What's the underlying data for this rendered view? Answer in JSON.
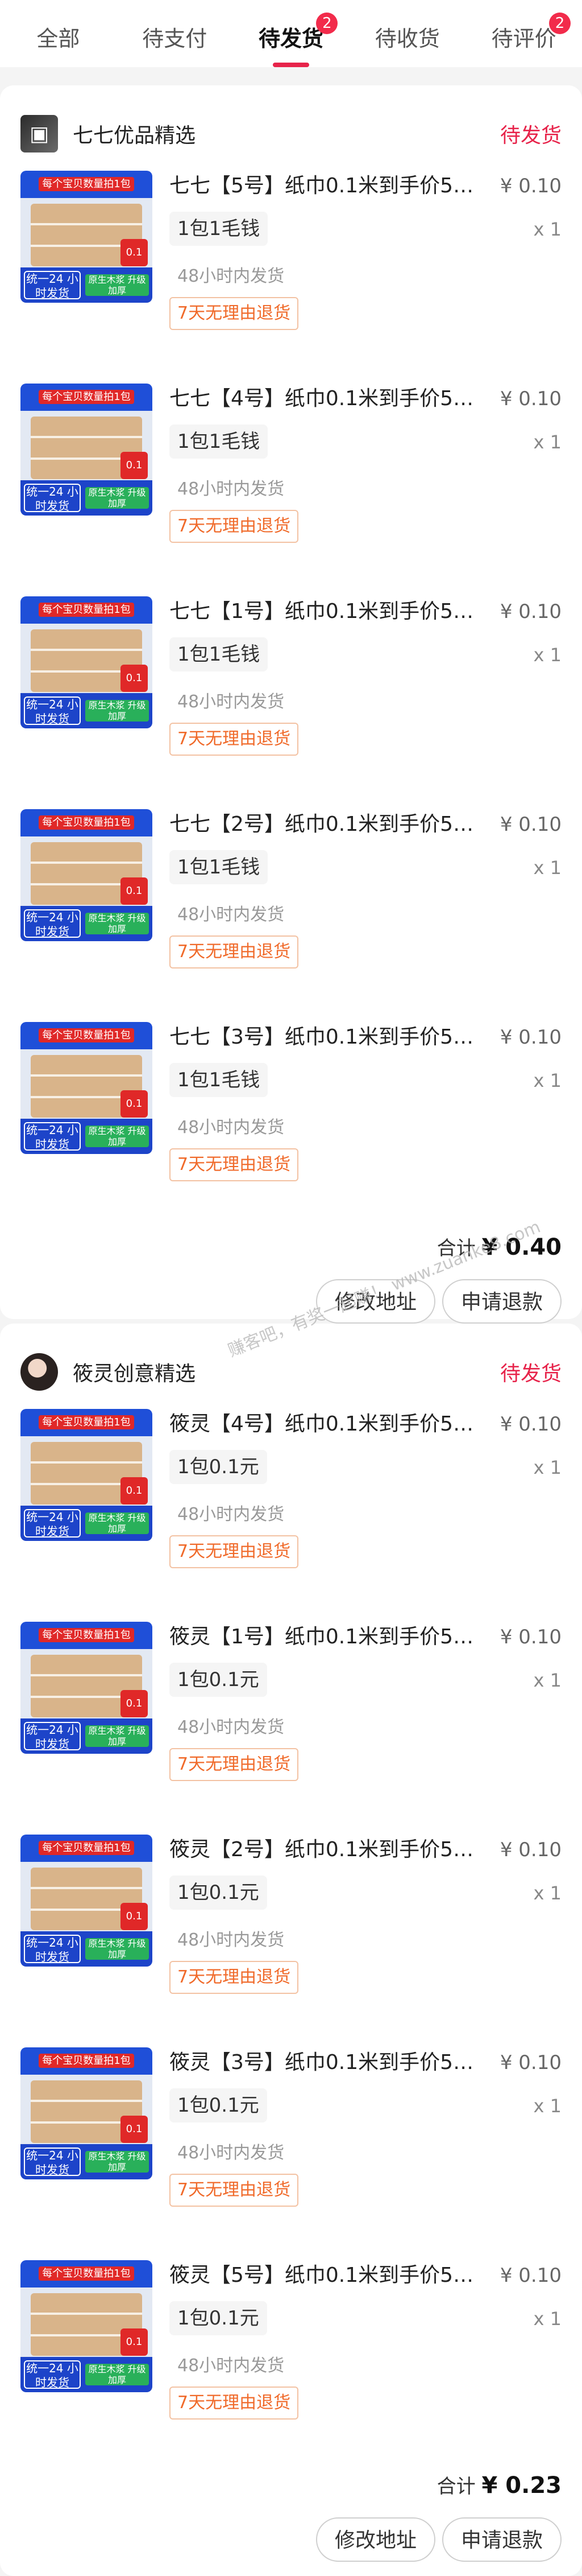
{
  "tabs": [
    {
      "label": "全部",
      "badge": ""
    },
    {
      "label": "待支付",
      "badge": ""
    },
    {
      "label": "待发货",
      "badge": "2"
    },
    {
      "label": "待收货",
      "badge": ""
    },
    {
      "label": "待评价",
      "badge": "2"
    }
  ],
  "orders": [
    {
      "shop": "七七优品精选",
      "status": "待发货",
      "items": [
        {
          "title": "七七【5号】纸巾0.1米到手价5个链…",
          "price": "¥ 0.10",
          "qty": "x 1",
          "spec": "1包1毛钱",
          "ship": "48小时内发货",
          "ret": "7天无理由退货"
        },
        {
          "title": "七七【4号】纸巾0.1米到手价5个链…",
          "price": "¥ 0.10",
          "qty": "x 1",
          "spec": "1包1毛钱",
          "ship": "48小时内发货",
          "ret": "7天无理由退货"
        },
        {
          "title": "七七【1号】纸巾0.1米到手价5个链…",
          "price": "¥ 0.10",
          "qty": "x 1",
          "spec": "1包1毛钱",
          "ship": "48小时内发货",
          "ret": "7天无理由退货"
        },
        {
          "title": "七七【2号】纸巾0.1米到手价5个链…",
          "price": "¥ 0.10",
          "qty": "x 1",
          "spec": "1包1毛钱",
          "ship": "48小时内发货",
          "ret": "7天无理由退货"
        },
        {
          "title": "七七【3号】纸巾0.1米到手价5个链…",
          "price": "¥ 0.10",
          "qty": "x 1",
          "spec": "1包1毛钱",
          "ship": "48小时内发货",
          "ret": "7天无理由退货"
        }
      ],
      "total_label": "合计",
      "total": "¥ 0.40",
      "btn_address": "修改地址",
      "btn_refund": "申请退款"
    },
    {
      "shop": "筱灵创意精选",
      "status": "待发货",
      "items": [
        {
          "title": "筱灵【4号】纸巾0.1米到手价5个链…",
          "price": "¥ 0.10",
          "qty": "x 1",
          "spec": "1包0.1元",
          "ship": "48小时内发货",
          "ret": "7天无理由退货"
        },
        {
          "title": "筱灵【1号】纸巾0.1米到手价5个链…",
          "price": "¥ 0.10",
          "qty": "x 1",
          "spec": "1包0.1元",
          "ship": "48小时内发货",
          "ret": "7天无理由退货"
        },
        {
          "title": "筱灵【2号】纸巾0.1米到手价5个链…",
          "price": "¥ 0.10",
          "qty": "x 1",
          "spec": "1包0.1元",
          "ship": "48小时内发货",
          "ret": "7天无理由退货"
        },
        {
          "title": "筱灵【3号】纸巾0.1米到手价5个链…",
          "price": "¥ 0.10",
          "qty": "x 1",
          "spec": "1包0.1元",
          "ship": "48小时内发货",
          "ret": "7天无理由退货"
        },
        {
          "title": "筱灵【5号】纸巾0.1米到手价5个链…",
          "price": "¥ 0.10",
          "qty": "x 1",
          "spec": "1包0.1元",
          "ship": "48小时内发货",
          "ret": "7天无理由退货"
        }
      ],
      "total_label": "合计",
      "total": "¥ 0.23",
      "btn_address": "修改地址",
      "btn_refund": "申请退款"
    }
  ],
  "thumb": {
    "top_text": "每个宝贝数量拍1包",
    "badge_text": "0.1",
    "left_text": "统一24 小时发货",
    "right_text": "原生木浆 升级加厚"
  },
  "watermark": "赚客吧，有奖一起赚！ www.zuanke8.com",
  "colors": {
    "accent": "#e7234a",
    "return_tag": "#f06a2a"
  }
}
